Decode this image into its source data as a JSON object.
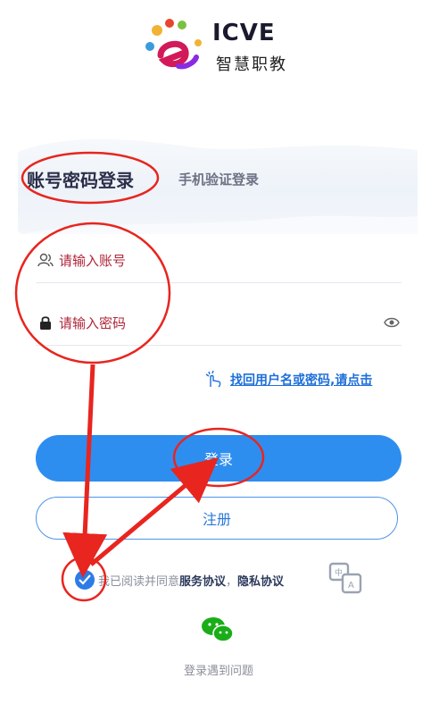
{
  "brand": {
    "name": "ICVE",
    "subtitle": "智慧职教"
  },
  "tabs": {
    "password_login": "账号密码登录",
    "sms_login": "手机验证登录"
  },
  "fields": {
    "account_placeholder": "请输入账号",
    "password_placeholder": "请输入密码"
  },
  "forgot": {
    "link": "找回用户名或密码,请点击"
  },
  "buttons": {
    "login": "登录",
    "register": "注册"
  },
  "agreement": {
    "prefix": "我已阅读并同意",
    "service": "服务协议",
    "separator": "，",
    "privacy": "隐私协议"
  },
  "help": {
    "text": "登录遇到问题"
  },
  "colors": {
    "primary": "#2d8ef0",
    "annotation": "#e8251f",
    "placeholder": "#b0263a"
  }
}
